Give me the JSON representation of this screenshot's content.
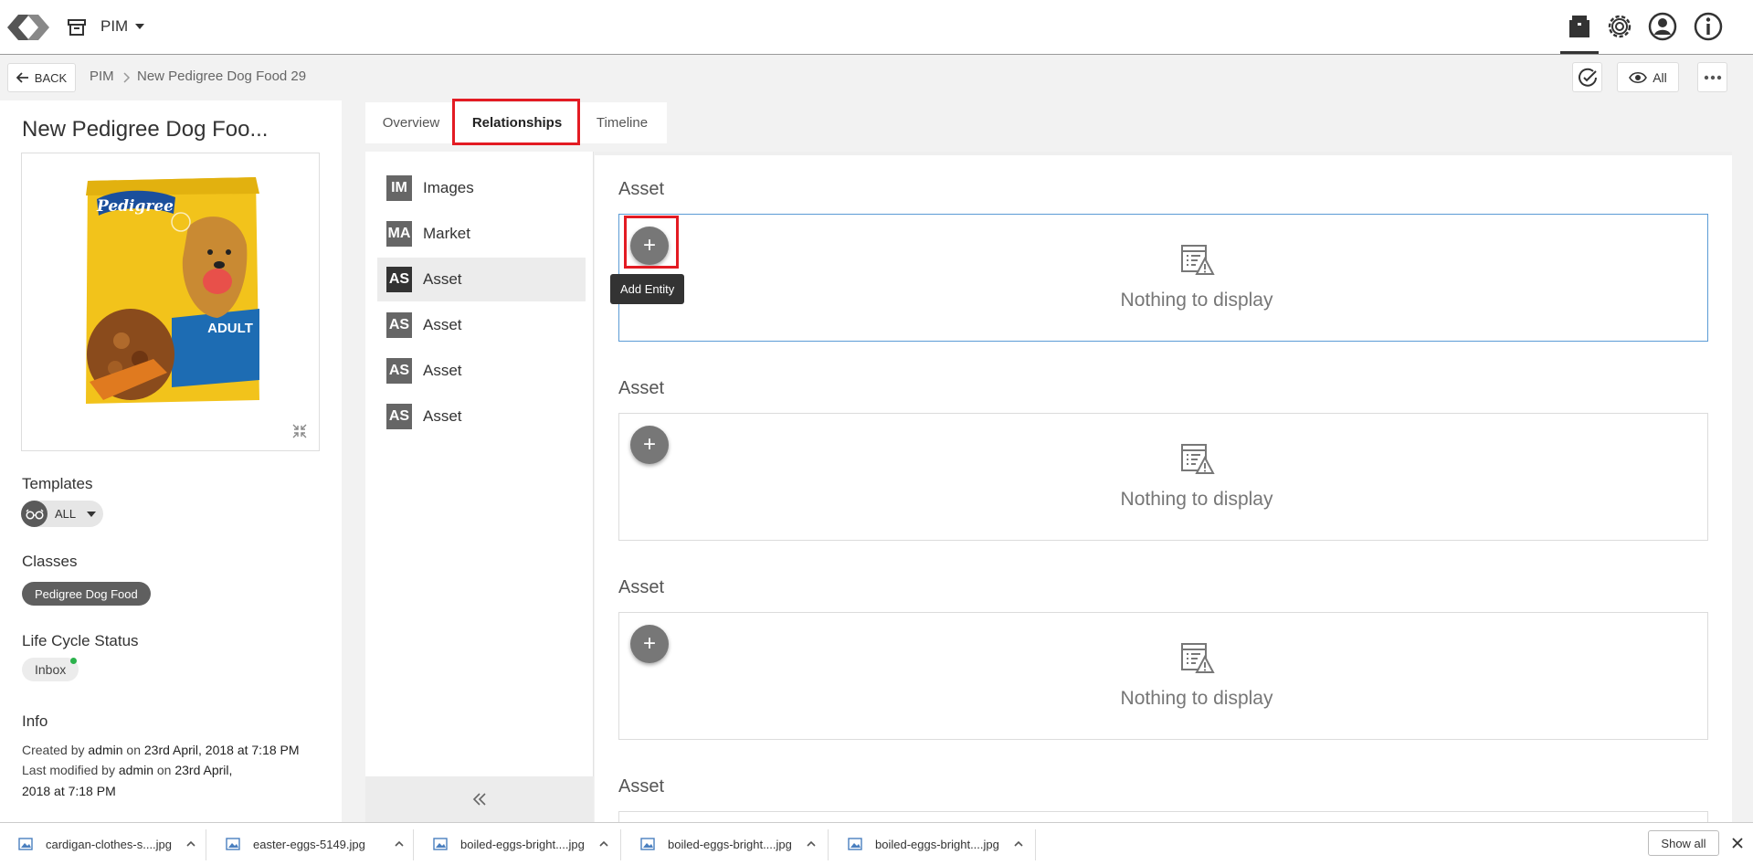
{
  "app": {
    "name": "PIM",
    "icons": [
      "logo-icon",
      "archive-icon",
      "caret-down-icon",
      "workspace-icon",
      "gear-icon",
      "user-icon",
      "info-icon"
    ]
  },
  "subheader": {
    "back_label": "BACK",
    "breadcrumb": [
      "PIM",
      "New Pedigree Dog Food 29"
    ],
    "view_label": "All"
  },
  "entity": {
    "title": "New Pedigree Dog Foo...",
    "templates_label": "Templates",
    "template_value": "ALL",
    "classes_label": "Classes",
    "class_value": "Pedigree Dog Food",
    "lifecycle_label": "Life Cycle Status",
    "lifecycle_value": "Inbox",
    "lifecycle_color": "#2bb24c",
    "info_label": "Info",
    "info": {
      "created_by_prefix": "Created by",
      "created_by": "admin",
      "created_on_prefix": "on",
      "created_on": "23rd April, 2018 at 7:18 PM",
      "modified_by_prefix": "Last modified by",
      "modified_by": "admin",
      "modified_on_prefix": "on",
      "modified_on_1": "23rd April,",
      "modified_on_2": "2018 at 7:18 PM"
    },
    "image_text": {
      "brand": "Pedigree",
      "variant": "ADULT"
    }
  },
  "tabs": [
    {
      "label": "Overview",
      "active": false
    },
    {
      "label": "Relationships",
      "active": true
    },
    {
      "label": "Timeline",
      "active": false
    }
  ],
  "relationships": [
    {
      "badge": "IM",
      "label": "Images",
      "selected": false
    },
    {
      "badge": "MA",
      "label": "Market",
      "selected": false
    },
    {
      "badge": "AS",
      "label": "Asset",
      "selected": true
    },
    {
      "badge": "AS",
      "label": "Asset",
      "selected": false
    },
    {
      "badge": "AS",
      "label": "Asset",
      "selected": false
    },
    {
      "badge": "AS",
      "label": "Asset",
      "selected": false
    }
  ],
  "sections": [
    {
      "title": "Asset",
      "empty_text": "Nothing to display",
      "add_symbol": "+"
    },
    {
      "title": "Asset",
      "empty_text": "Nothing to display",
      "add_symbol": "+"
    },
    {
      "title": "Asset",
      "empty_text": "Nothing to display",
      "add_symbol": "+"
    },
    {
      "title": "Asset"
    }
  ],
  "tooltip": "Add Entity",
  "downloads": {
    "items": [
      "cardigan-clothes-s....jpg",
      "easter-eggs-5149.jpg",
      "boiled-eggs-bright....jpg",
      "boiled-eggs-bright....jpg",
      "boiled-eggs-bright....jpg"
    ],
    "show_all": "Show all"
  },
  "colors": {
    "highlight": "#e31b23",
    "focus_border": "#5b9bd5",
    "accent_dark": "#333333"
  }
}
